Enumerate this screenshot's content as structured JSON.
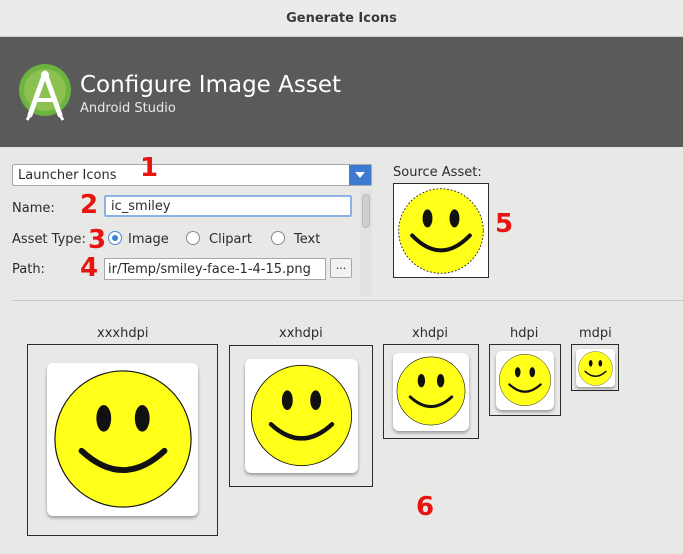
{
  "window": {
    "title": "Generate Icons"
  },
  "header": {
    "title": "Configure Image Asset",
    "subtitle": "Android Studio"
  },
  "form": {
    "icon_type": "Launcher Icons",
    "name_label": "Name:",
    "name_value": "ic_smiley",
    "asset_type_label": "Asset Type:",
    "asset_types": [
      "Image",
      "Clipart",
      "Text"
    ],
    "selected_asset_type": "Image",
    "path_label": "Path:",
    "path_value": "ir/Temp/smiley-face-1-4-15.png",
    "browse_label": "..."
  },
  "source": {
    "label": "Source Asset:"
  },
  "densities": [
    "xxxhdpi",
    "xxhdpi",
    "xhdpi",
    "hdpi",
    "mdpi"
  ],
  "annotations": [
    "1",
    "2",
    "3",
    "4",
    "5",
    "6"
  ],
  "icons": {
    "logo": "android-studio-logo",
    "dropdown": "chevron-down-icon",
    "preview": "smiley-face-icon"
  },
  "colors": {
    "header_bg": "#5a5a5a",
    "accent": "#3e7bd0",
    "annotation": "#e8140f",
    "smiley_fill": "#ffff1a"
  }
}
